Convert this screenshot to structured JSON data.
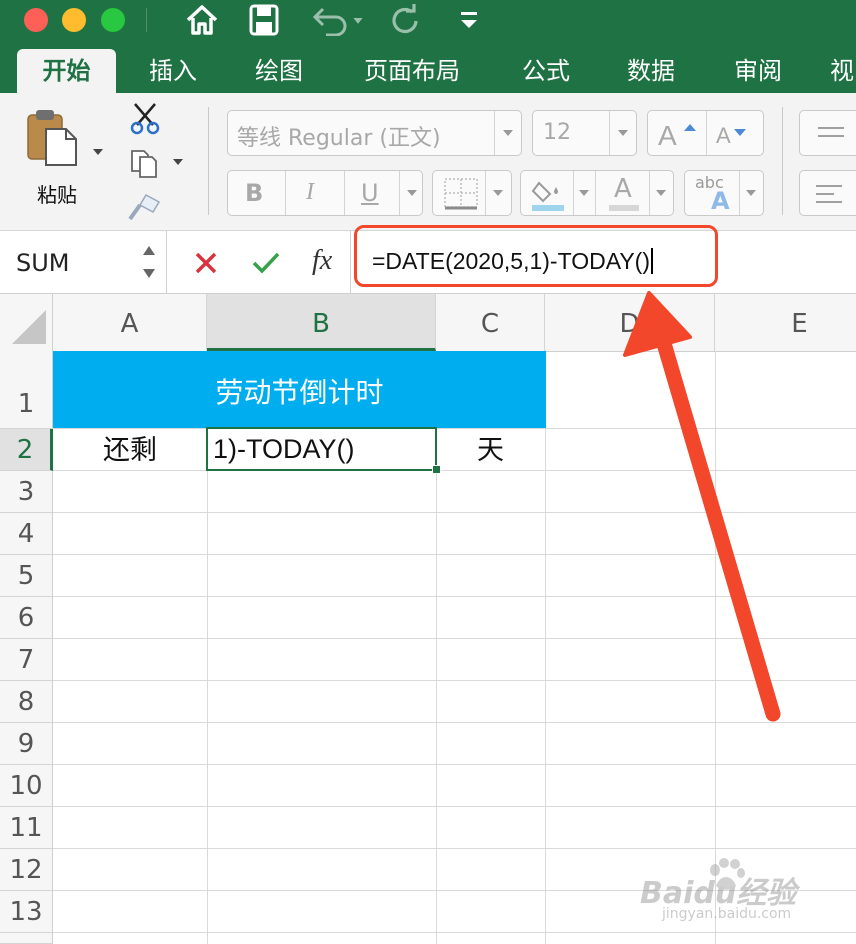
{
  "quick_access": {
    "icons": [
      "home-icon",
      "save-icon",
      "undo-icon",
      "redo-icon",
      "customize-dropdown-icon"
    ]
  },
  "ribbon_tabs": [
    "开始",
    "插入",
    "绘图",
    "页面布局",
    "公式",
    "数据",
    "审阅",
    "视"
  ],
  "active_tab": "开始",
  "clipboard": {
    "paste_label": "粘贴"
  },
  "font": {
    "name": "等线 Regular (正文)",
    "size": "12",
    "bold": "B",
    "italic": "I",
    "underline": "U",
    "font_color_letter": "A",
    "phonetic_label": "abc"
  },
  "formula_bar": {
    "name_box": "SUM",
    "fx_label": "fx",
    "formula": "=DATE(2020,5,1)-TODAY()"
  },
  "sheet": {
    "columns": [
      "A",
      "B",
      "C",
      "D",
      "E"
    ],
    "rows": [
      "1",
      "2",
      "3",
      "4",
      "5",
      "6",
      "7",
      "8",
      "9",
      "10",
      "11",
      "12",
      "13"
    ],
    "title_cell": "劳动节倒计时",
    "cells": {
      "A2": "还剩",
      "B2": "1)-TODAY()",
      "C2": "天"
    },
    "active_column": "B",
    "active_row": "2"
  },
  "colors": {
    "excel_green": "#1f7244",
    "title_fill": "#00aeef",
    "title_text": "#ffffff",
    "annotation_red": "#f2472b"
  },
  "watermark": {
    "brand": "Baidu经验",
    "url": "jingyan.baidu.com"
  }
}
